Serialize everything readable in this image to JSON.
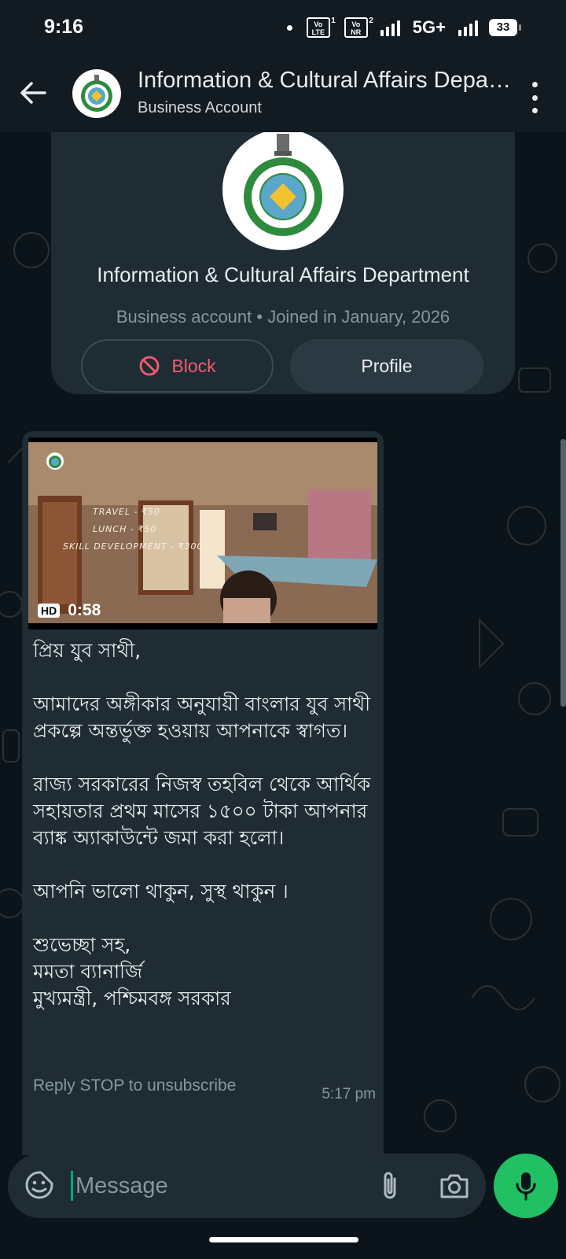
{
  "status_bar": {
    "time": "9:16",
    "sim1": "Vo LTE",
    "sim1_slot": "1",
    "sim2": "Vo NR",
    "sim2_slot": "2",
    "network": "5G+",
    "battery": "33"
  },
  "header": {
    "title": "Information & Cultural Affairs Department",
    "subtitle": "Business Account",
    "back_icon": "arrow-left",
    "menu_icon": "more-vertical"
  },
  "info_card": {
    "name": "Information & Cultural Affairs Department",
    "meta": "Business account • Joined in January, 2026",
    "block_label": "Block",
    "profile_label": "Profile"
  },
  "message": {
    "video_duration": "0:58",
    "video_quality": "HD",
    "video_overlay": [
      "TRAVEL - ₹50",
      "LUNCH - ₹50",
      "SKILL DEVELOPMENT - ₹300"
    ],
    "text": "প্রিয় যুব সাথী,\n\nআমাদের অঙ্গীকার অনুযায়ী বাংলার যুব সাথী প্রকল্পে অন্তর্ভুক্ত হওয়ায় আপনাকে স্বাগত।\n\nরাজ্য সরকারের নিজস্ব তহবিল থেকে আর্থিক সহায়তার প্রথম মাসের ১৫০০ টাকা আপনার ব্যাঙ্ক অ্যাকাউন্টে জমা করা হলো।\n\nআপনি ভালো থাকুন, সুস্থ থাকুন ।\n\nশুভেচ্ছা সহ,\nমমতা ব্যানার্জি\nমুখ্যমন্ত্রী, পশ্চিমবঙ্গ সরকার",
    "footer": "Reply STOP to unsubscribe",
    "time": "5:17 pm"
  },
  "composer": {
    "placeholder": "Message"
  },
  "colors": {
    "accent": "#21c063",
    "block_red": "#f15c6d",
    "bubble": "#202c33",
    "background": "#0b141a"
  }
}
